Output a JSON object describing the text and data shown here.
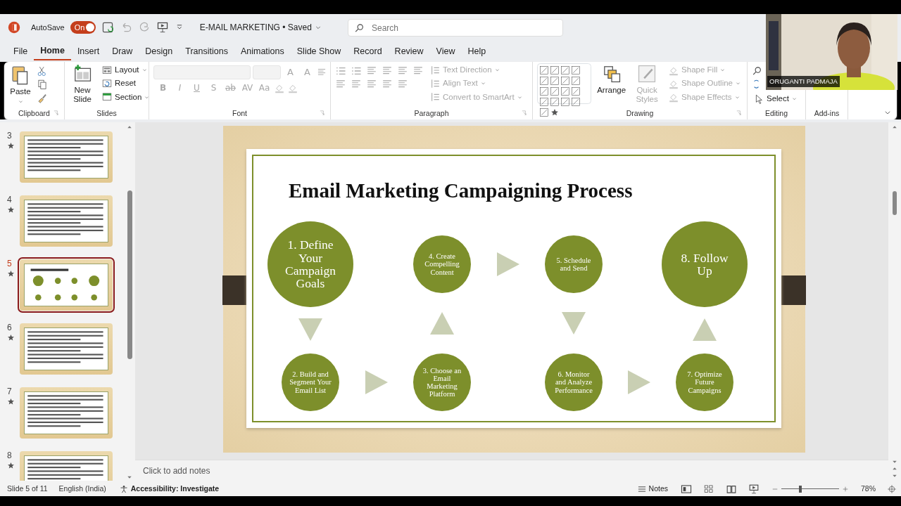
{
  "title_bar": {
    "autosave_label": "AutoSave",
    "autosave": {
      "label": "On",
      "on": true
    },
    "document_title": "E-MAIL MARKETING • Saved",
    "search": {
      "placeholder": "Search"
    }
  },
  "menu_tabs": [
    {
      "label": "File",
      "selected": false
    },
    {
      "label": "Home",
      "selected": true
    },
    {
      "label": "Insert",
      "selected": false
    },
    {
      "label": "Draw",
      "selected": false
    },
    {
      "label": "Design",
      "selected": false
    },
    {
      "label": "Transitions",
      "selected": false
    },
    {
      "label": "Animations",
      "selected": false
    },
    {
      "label": "Slide Show",
      "selected": false
    },
    {
      "label": "Record",
      "selected": false
    },
    {
      "label": "Review",
      "selected": false
    },
    {
      "label": "View",
      "selected": false
    },
    {
      "label": "Help",
      "selected": false
    }
  ],
  "ribbon": {
    "clipboard": {
      "paste": "Paste",
      "group_label": "Clipboard"
    },
    "slides": {
      "new_slide": "New Slide",
      "commands": [
        "Layout",
        "Reset",
        "Section"
      ],
      "group_label": "Slides"
    },
    "font": {
      "size_buttons": [
        "A",
        "A"
      ],
      "buttons": [
        "B",
        "I",
        "U",
        "S",
        "ab",
        "AV",
        "Aa"
      ],
      "disabled": true,
      "group_label": "Font"
    },
    "paragraph": {
      "commands": [
        "Text Direction",
        "Align Text",
        "Convert to SmartArt"
      ],
      "disabled": true,
      "group_label": "Paragraph"
    },
    "drawing": {
      "arrange": "Arrange",
      "quick_styles": "Quick Styles",
      "quick_styles_disabled": true,
      "commands": [
        "Shape Fill",
        "Shape Outline",
        "Shape Effects"
      ],
      "commands_disabled": true,
      "group_label": "Drawing"
    },
    "editing": {
      "select": "Select",
      "group_label": "Editing"
    },
    "add_ins": {
      "group_label": "Add-ins"
    }
  },
  "video": {
    "name_tag": "ORUGANTI PADMAJA"
  },
  "thumbnails": [
    {
      "number": "3",
      "kind": "text",
      "selected": false
    },
    {
      "number": "4",
      "kind": "text",
      "selected": false
    },
    {
      "number": "5",
      "kind": "diagram",
      "selected": true
    },
    {
      "number": "6",
      "kind": "text",
      "selected": false
    },
    {
      "number": "7",
      "kind": "text",
      "selected": false
    },
    {
      "number": "8",
      "kind": "text",
      "selected": false
    }
  ],
  "slide": {
    "title": "Email Marketing Campaigning Process",
    "steps": [
      {
        "label": "1. Define Your Campaign Goals",
        "kind": "large"
      },
      {
        "label": "4. Create Compelling Content",
        "kind": "small"
      },
      {
        "label": "5. Schedule and Send",
        "kind": "small"
      },
      {
        "label": "8. Follow Up",
        "kind": "large"
      },
      {
        "label": "2. Build and Segment Your Email List",
        "kind": "small"
      },
      {
        "label": "3. Choose an Email Marketing Platform",
        "kind": "small"
      },
      {
        "label": "6. Monitor and Analyze Performance",
        "kind": "small"
      },
      {
        "label": "7. Optimize Future Campaigns",
        "kind": "small"
      }
    ]
  },
  "notes": {
    "placeholder": "Click to add notes"
  },
  "status_bar": {
    "slide": "Slide 5 of 11",
    "language": "English (India)",
    "accessibility": "Accessibility: Investigate",
    "notes": "Notes",
    "zoom": {
      "level": 0.32
    },
    "zoom_reading": "78%"
  }
}
